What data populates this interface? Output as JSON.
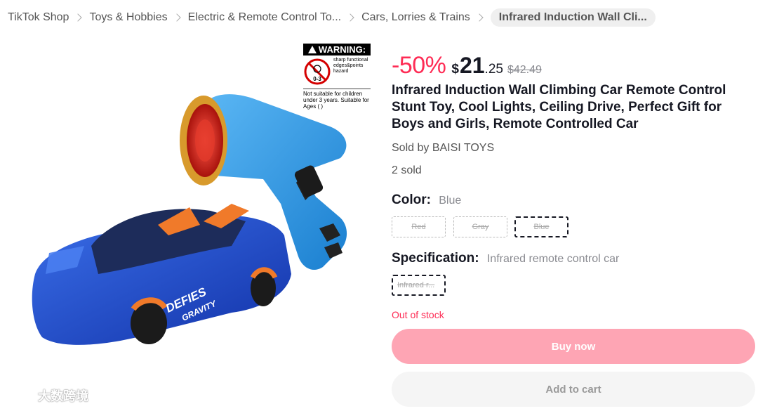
{
  "breadcrumb": {
    "items": [
      "TikTok Shop",
      "Toys & Hobbies",
      "Electric & Remote Control To...",
      "Cars, Lorries & Trains"
    ],
    "current": "Infrared Induction Wall Cli..."
  },
  "warning_label": {
    "heading": "WARNING:",
    "badge": "0-3",
    "hazard_text": "sharp functional edges&points hazard",
    "footer": "Not suitable for children under 3 years. Suitable for Ages ( )"
  },
  "product_image": {
    "car_text_1": "DEFIES",
    "car_text_2": "GRAVITY"
  },
  "price": {
    "discount": "-50%",
    "currency": "$",
    "whole": "21",
    "cents": ".25",
    "original": "$42.49"
  },
  "product": {
    "title": "Infrared Induction Wall Climbing Car Remote Control Stunt Toy, Cool Lights, Ceiling Drive, Perfect Gift for Boys and Girls, Remote Controlled Car",
    "seller": "Sold by BAISI TOYS",
    "sold": "2 sold"
  },
  "color": {
    "label": "Color:",
    "selected": "Blue",
    "options": [
      "Red",
      "Gray",
      "Blue"
    ]
  },
  "specification": {
    "label": "Specification:",
    "selected": "Infrared remote control car",
    "options": [
      "Infrared r..."
    ]
  },
  "stock_status": "Out of stock",
  "actions": {
    "buy": "Buy now",
    "cart": "Add to cart"
  },
  "watermark": "大数跨境",
  "colors": {
    "accent": "#fe2c55",
    "buy_button": "#fea5b4",
    "toy_blue": "#1f8ee0"
  }
}
